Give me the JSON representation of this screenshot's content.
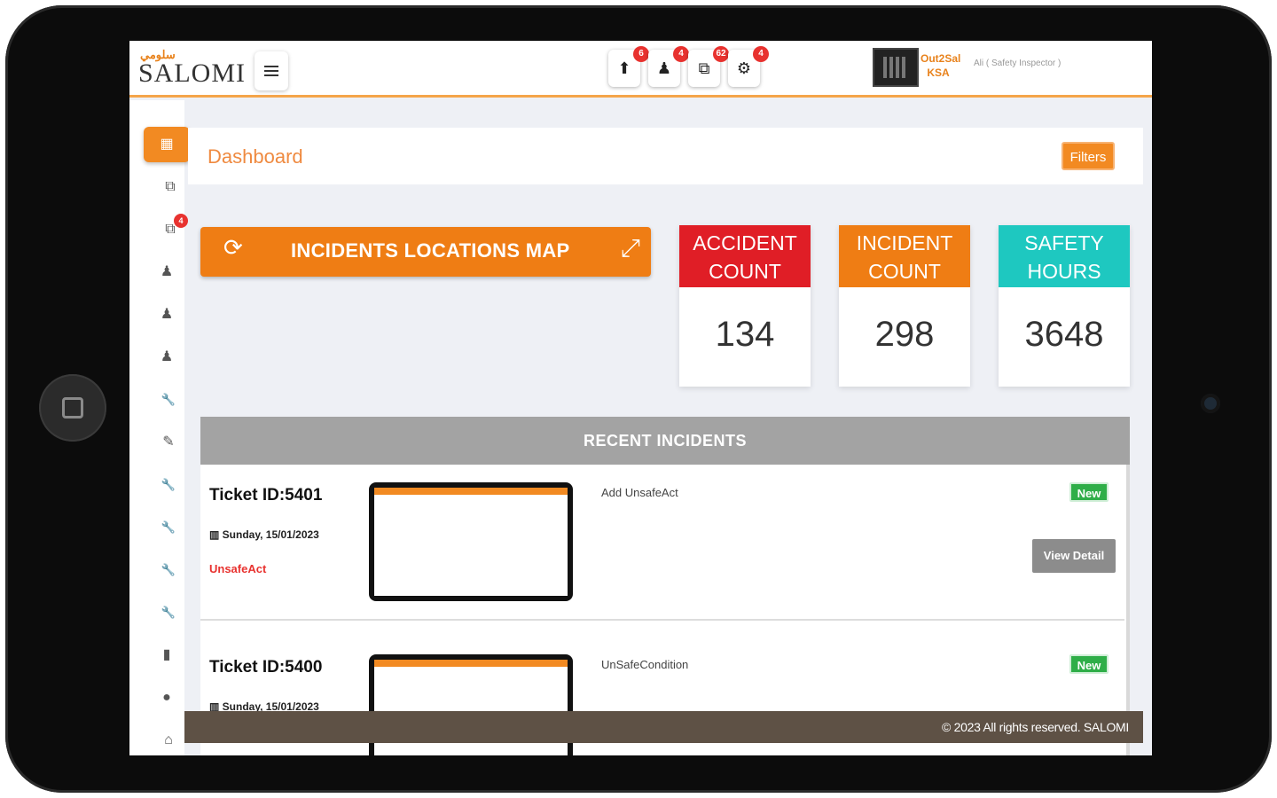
{
  "header": {
    "logo_arabic": "سلومي",
    "logo_text": "SALOMI",
    "icons": [
      {
        "name": "upload-icon",
        "glyph": "⬆",
        "badge": "6"
      },
      {
        "name": "person-icon",
        "glyph": "♟",
        "badge": "4"
      },
      {
        "name": "copy-icon",
        "glyph": "⧉",
        "badge": "62"
      },
      {
        "name": "gear-icon",
        "glyph": "⚙",
        "badge": "4"
      }
    ],
    "user_name": "Out2Sal KSA",
    "user_role": "Ali ( Safety Inspector )"
  },
  "sidebar": {
    "items": [
      {
        "name": "sidebar-item-dashboard",
        "glyph": "▦",
        "badge": ""
      },
      {
        "name": "sidebar-item-copy",
        "glyph": "⧉",
        "badge": ""
      },
      {
        "name": "sidebar-item-alerts",
        "glyph": "⧉",
        "badge": "4"
      },
      {
        "name": "sidebar-item-person-1",
        "glyph": "♟",
        "badge": ""
      },
      {
        "name": "sidebar-item-person-2",
        "glyph": "♟",
        "badge": ""
      },
      {
        "name": "sidebar-item-person-3",
        "glyph": "♟",
        "badge": ""
      },
      {
        "name": "sidebar-item-tool-1",
        "glyph": "🔧",
        "badge": ""
      },
      {
        "name": "sidebar-item-edit",
        "glyph": "✎",
        "badge": ""
      },
      {
        "name": "sidebar-item-tool-2",
        "glyph": "🔧",
        "badge": ""
      },
      {
        "name": "sidebar-item-tool-3",
        "glyph": "🔧",
        "badge": ""
      },
      {
        "name": "sidebar-item-tool-4",
        "glyph": "🔧",
        "badge": ""
      },
      {
        "name": "sidebar-item-tool-5",
        "glyph": "🔧",
        "badge": ""
      },
      {
        "name": "sidebar-item-document",
        "glyph": "▮",
        "badge": ""
      },
      {
        "name": "sidebar-item-circle",
        "glyph": "●",
        "badge": ""
      },
      {
        "name": "sidebar-item-bank",
        "glyph": "⌂",
        "badge": ""
      }
    ]
  },
  "page": {
    "title": "Dashboard",
    "filters_label": "Filters"
  },
  "map_button": {
    "refresh_glyph": "⟳",
    "label": "INCIDENTS LOCATIONS MAP",
    "expand_glyph": "⤢"
  },
  "stats": [
    {
      "line1": "ACCIDENT",
      "line2": "COUNT",
      "value": "134",
      "color": "#e01e26"
    },
    {
      "line1": "INCIDENT",
      "line2": "COUNT",
      "value": "298",
      "color": "#ef7d14"
    },
    {
      "line1": "SAFETY",
      "line2": "HOURS",
      "value": "3648",
      "color": "#1ec8c0"
    }
  ],
  "recent": {
    "title": "RECENT INCIDENTS",
    "rows": [
      {
        "ticket": "Ticket ID:5401",
        "date": "▥ Sunday, 15/01/2023",
        "type": "UnsafeAct",
        "description": "Add UnsafeAct",
        "status": "New",
        "view_label": "View Detail"
      },
      {
        "ticket": "Ticket ID:5400",
        "date": "▥ Sunday, 15/01/2023",
        "type": "",
        "description": "UnSafeCondition",
        "status": "New",
        "view_label": ""
      }
    ]
  },
  "footer": {
    "text": "© 2023 All rights reserved. SALOMI"
  },
  "colors": {
    "accent": "#ef7d14",
    "accident": "#e01e26",
    "safety": "#1ec8c0",
    "status_new": "#2fae48",
    "footer": "#5e5145"
  }
}
